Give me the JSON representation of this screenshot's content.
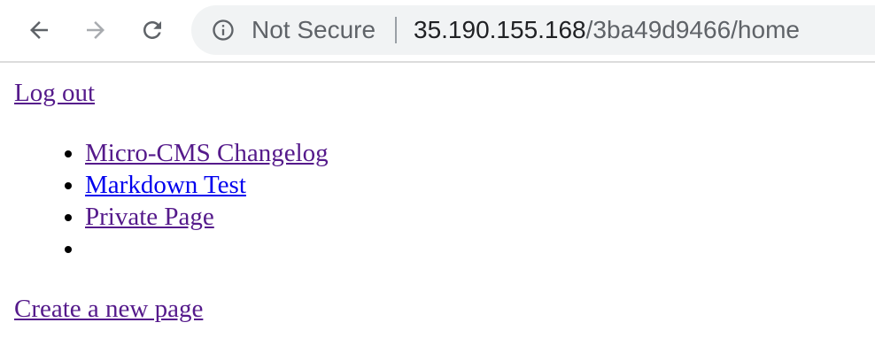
{
  "browser": {
    "security_label": "Not Secure",
    "url_host": "35.190.155.168",
    "url_path": "/3ba49d9466/home",
    "icons": {
      "back": "arrow-left-icon",
      "forward": "arrow-right-icon",
      "reload": "reload-icon",
      "security": "info-icon"
    },
    "colors": {
      "omnibox_bg": "#f1f3f4",
      "icon_active": "#5f6368",
      "icon_disabled": "#a8abaf"
    }
  },
  "page": {
    "logout_link": "Log out",
    "pages": [
      {
        "label": "Micro-CMS Changelog",
        "visited": true
      },
      {
        "label": "Markdown Test",
        "visited": false
      },
      {
        "label": "Private Page",
        "visited": true
      },
      {
        "label": "",
        "visited": false
      }
    ],
    "create_link": "Create a new page",
    "colors": {
      "link_visited": "#551a8b",
      "link_unvisited": "#0000ee"
    }
  }
}
